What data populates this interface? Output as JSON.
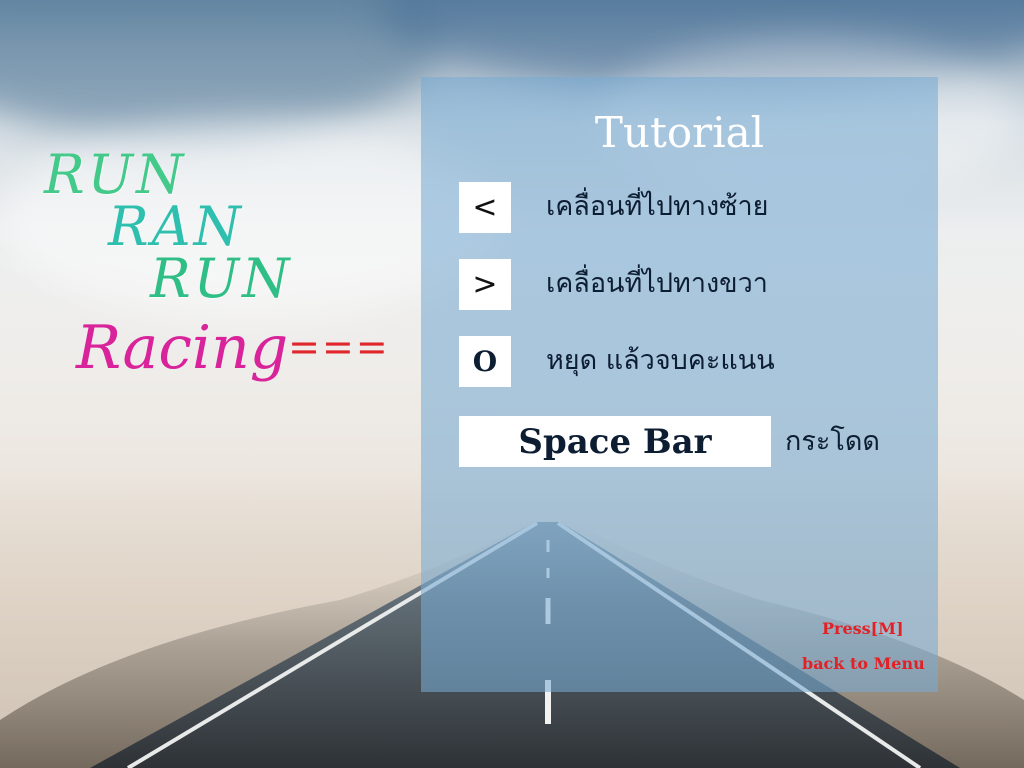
{
  "logo": {
    "line1": "RUN",
    "line2": "RAN",
    "line3": "RUN",
    "racing": "Racing",
    "racing_suffix": "==="
  },
  "tutorial": {
    "title": "Tutorial",
    "controls": [
      {
        "key": "<",
        "description": "เคลื่อนที่ไปทางซ้าย"
      },
      {
        "key": ">",
        "description": "เคลื่อนที่ไปทางขวา"
      },
      {
        "key": "O",
        "description": "หยุด แล้วจบคะแนน"
      },
      {
        "key": "Space Bar",
        "description": "กระโดด"
      }
    ],
    "back_line1": "Press[M]",
    "back_line2": "back to Menu"
  },
  "colors": {
    "logo_green": "#43c98a",
    "logo_teal": "#2fbfae",
    "logo_pink": "#d8239b",
    "logo_red": "#e0252b",
    "panel": "#78aad2",
    "back_text": "#e32024"
  }
}
